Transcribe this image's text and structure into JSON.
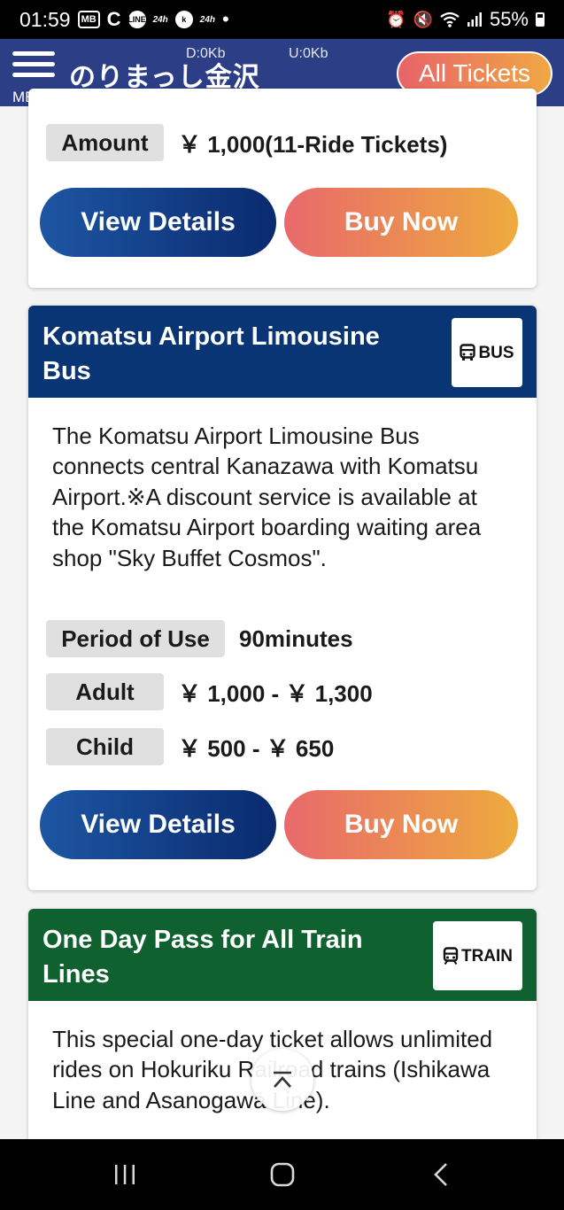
{
  "status_bar": {
    "time": "01:59",
    "left_icons": [
      "MB",
      "C",
      "LINE",
      "24h",
      "k",
      "24h"
    ],
    "battery": "55%"
  },
  "header": {
    "menu_label": "MENU",
    "logo": "のりまっし金沢",
    "download": "D:0Kb",
    "upload": "U:0Kb",
    "all_tickets": "All Tickets"
  },
  "cards": [
    {
      "amount_label": "Amount",
      "amount_value": "￥ 1,000(11-Ride Tickets)",
      "view_label": "View Details",
      "buy_label": "Buy Now"
    },
    {
      "title": "Komatsu Airport Limousine Bus",
      "type_label": "BUS",
      "description": "The Komatsu Airport Limousine Bus connects central Kanazawa with Komatsu Airport.※A discount service is available at the Komatsu Airport boarding waiting area shop \"Sky Buffet Cosmos\".",
      "period_label": "Period of Use",
      "period_value": "90minutes",
      "adult_label": "Adult",
      "adult_value": "￥ 1,000 - ￥ 1,300",
      "child_label": "Child",
      "child_value": "￥ 500 - ￥ 650",
      "view_label": "View Details",
      "buy_label": "Buy Now"
    },
    {
      "title": "One Day Pass for All Train Lines",
      "type_label": "TRAIN",
      "description": "This special one-day ticket allows unlimited rides on Hokuriku Railroad trains (Ishikawa Line and Asanogawa Line)."
    }
  ],
  "colors": {
    "header_bg": "#2b3e86",
    "card_head_blue": "#0a3575",
    "card_head_green": "#0f6130",
    "buy_gradient": [
      "#e8696b",
      "#eeab3e"
    ],
    "view_gradient": [
      "#1d56a3",
      "#0a2a6e"
    ]
  },
  "icons": {
    "menu": "hamburger-icon",
    "bus": "bus-icon",
    "train": "train-icon",
    "scroll_top": "chevron-up-icon",
    "nav": [
      "recent-apps-icon",
      "home-icon",
      "back-icon"
    ]
  }
}
